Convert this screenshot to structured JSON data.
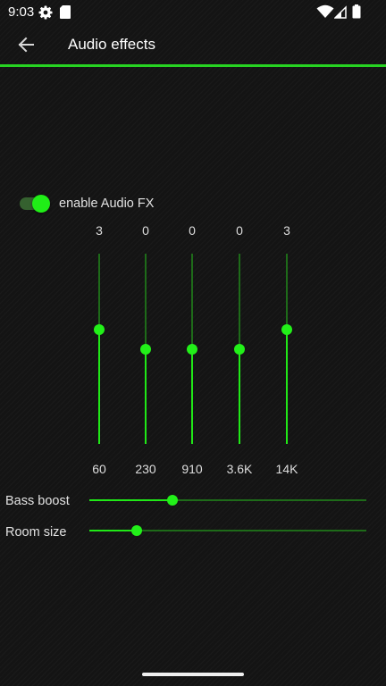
{
  "status_bar": {
    "time": "9:03",
    "left_icons": [
      "settings-gear-icon",
      "sd-card-icon"
    ],
    "right_icons": [
      "wifi-icon",
      "signal-icon",
      "battery-icon"
    ]
  },
  "app_bar": {
    "back_icon": "arrow-left-icon",
    "title": "Audio effects"
  },
  "audio_fx": {
    "label": "enable Audio FX",
    "enabled": true
  },
  "equalizer": {
    "bands": [
      {
        "frequency": "60",
        "value": "3",
        "level": 3
      },
      {
        "frequency": "230",
        "value": "0",
        "level": 0
      },
      {
        "frequency": "910",
        "value": "0",
        "level": 0
      },
      {
        "frequency": "3.6K",
        "value": "0",
        "level": 0
      },
      {
        "frequency": "14K",
        "value": "3",
        "level": 3
      }
    ],
    "min_level": -15,
    "max_level": 15
  },
  "bass_boost": {
    "label": "Bass boost",
    "fraction": 0.3
  },
  "room_size": {
    "label": "Room size",
    "fraction": 0.17
  },
  "colors": {
    "accent": "#20ee17",
    "track": "#1e6b19",
    "background": "#141414"
  }
}
